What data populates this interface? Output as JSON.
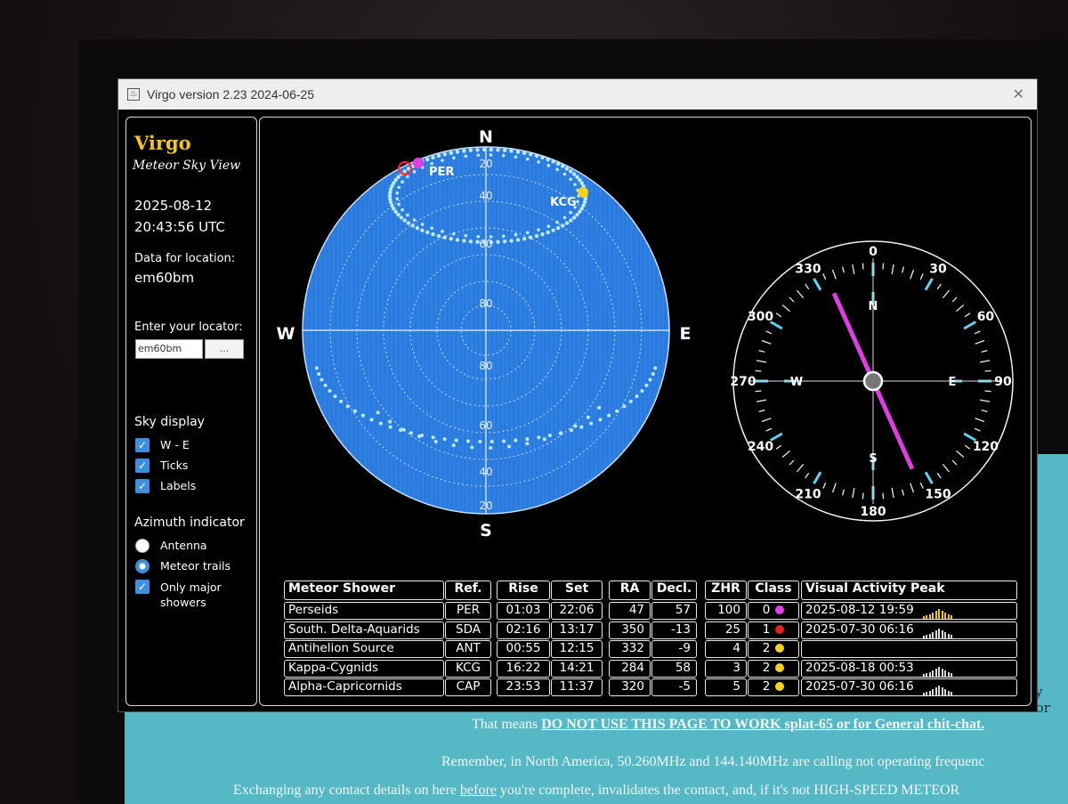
{
  "window": {
    "title": "Virgo version 2.23 2024-06-25",
    "close_icon": "close-icon"
  },
  "sidebar": {
    "brand": "Virgo",
    "subtitle": "Meteor Sky View",
    "date": "2025-08-12",
    "time": "20:43:56 UTC",
    "location_label": "Data for location:",
    "location_value": "em60bm",
    "locator_label": "Enter your locator:",
    "locator_input_value": "em60bm",
    "locator_button_label": "...",
    "sky_display_heading": "Sky display",
    "sky_display_options": [
      {
        "label": "W - E",
        "checked": true
      },
      {
        "label": "Ticks",
        "checked": true
      },
      {
        "label": "Labels",
        "checked": true
      }
    ],
    "azimuth_heading": "Azimuth indicator",
    "azimuth_options": [
      {
        "label": "Antenna",
        "selected": false
      },
      {
        "label": "Meteor trails",
        "selected": true
      }
    ],
    "only_major_label": "Only major showers",
    "only_major_checked": true
  },
  "sky": {
    "north": "N",
    "south": "S",
    "west": "W",
    "east": "E",
    "elevation_labels_north": [
      "20",
      "40",
      "60",
      "80"
    ],
    "elevation_labels_south": [
      "80",
      "60",
      "40",
      "20"
    ],
    "radiant_labels": [
      "PER",
      "KCG"
    ],
    "colors": {
      "sky_fill": "#2a7be0",
      "trail_dots": "#bfe9f5",
      "per_marker": "#e040e8",
      "kcg_marker": "#f2d21a",
      "red_circle": "#ff2a2a"
    }
  },
  "compass": {
    "labels": [
      "0",
      "30",
      "60",
      "90",
      "120",
      "150",
      "180",
      "210",
      "240",
      "270",
      "300",
      "330"
    ],
    "inner_labels": {
      "n": "N",
      "s": "S",
      "w": "W",
      "e": "E"
    },
    "needle_azimuth_deg": 336,
    "needle_color": "#e23ce6"
  },
  "table": {
    "headers": {
      "shower": "Meteor Shower",
      "ref": "Ref.",
      "rise": "Rise",
      "set": "Set",
      "ra": "RA",
      "decl": "Decl.",
      "zhr": "ZHR",
      "class": "Class",
      "peak": "Visual Activity Peak"
    },
    "rows": [
      {
        "name": "Perseids",
        "ref": "PER",
        "rise": "01:03",
        "set": "22:06",
        "ra": "47",
        "decl": "57",
        "zhr": "100",
        "cls": "0",
        "dot": "#e040e8",
        "peak": "2025-08-12   19:59",
        "bars": [
          3,
          4,
          5,
          7,
          9,
          11,
          9,
          7,
          5,
          4
        ],
        "bar_color": "#f0c020"
      },
      {
        "name": "South. Delta-Aquarids",
        "ref": "SDA",
        "rise": "02:16",
        "set": "13:17",
        "ra": "350",
        "decl": "-13",
        "zhr": "25",
        "cls": "1",
        "dot": "#e82020",
        "peak": "2025-07-30   06:16",
        "bars": [
          3,
          4,
          5,
          7,
          9,
          11,
          9,
          7,
          5,
          4
        ],
        "bar_color": "#d8d8d8"
      },
      {
        "name": "Antihelion Source",
        "ref": "ANT",
        "rise": "00:55",
        "set": "12:15",
        "ra": "332",
        "decl": "-9",
        "zhr": "4",
        "cls": "2",
        "dot": "#f2d21a",
        "peak": "",
        "bars": [],
        "bar_color": "#d8d8d8"
      },
      {
        "name": "Kappa-Cygnids",
        "ref": "KCG",
        "rise": "16:22",
        "set": "14:21",
        "ra": "284",
        "decl": "58",
        "zhr": "3",
        "cls": "2",
        "dot": "#f2d21a",
        "peak": "2025-08-18   00:53",
        "bars": [
          3,
          4,
          5,
          7,
          9,
          11,
          9,
          7,
          5,
          4
        ],
        "bar_color": "#d8d8d8"
      },
      {
        "name": "Alpha-Capricornids",
        "ref": "CAP",
        "rise": "23:53",
        "set": "11:37",
        "ra": "320",
        "decl": "-5",
        "zhr": "5",
        "cls": "2",
        "dot": "#f2d21a",
        "peak": "2025-07-30   06:16",
        "bars": [
          3,
          4,
          5,
          7,
          9,
          11,
          9,
          7,
          5,
          4
        ],
        "bar_color": "#d8d8d8"
      }
    ]
  },
  "background_page": {
    "line1_prefix": "That means ",
    "line1_link": "DO NOT USE THIS PAGE TO WORK splat-65 or for General chit-chat.",
    "line2": "Remember, in North America, 50.260MHz and 144.140MHz are calling not operating frequenc",
    "line3_prefix": "Exchanging any contact details on here ",
    "line3_link": "before",
    "line3_suffix": " you're complete, invalidates the contact, and, if it's not HIGH-SPEED METEOR",
    "cut_text": "ay nor"
  }
}
